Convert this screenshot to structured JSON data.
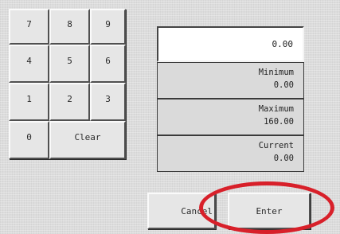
{
  "keypad": {
    "k7": "7",
    "k8": "8",
    "k9": "9",
    "k4": "4",
    "k5": "5",
    "k6": "6",
    "k1": "1",
    "k2": "2",
    "k3": "3",
    "k0": "0",
    "clear": "Clear"
  },
  "entry": {
    "value": "0.00"
  },
  "minimum": {
    "label": "Minimum",
    "value": "0.00"
  },
  "maximum": {
    "label": "Maximum",
    "value": "160.00"
  },
  "current": {
    "label": "Current",
    "value": "0.00"
  },
  "buttons": {
    "cancel": "Cancel",
    "enter": "Enter"
  },
  "annotation": {
    "color": "#d8202a",
    "shape": "ellipse-highlight"
  }
}
